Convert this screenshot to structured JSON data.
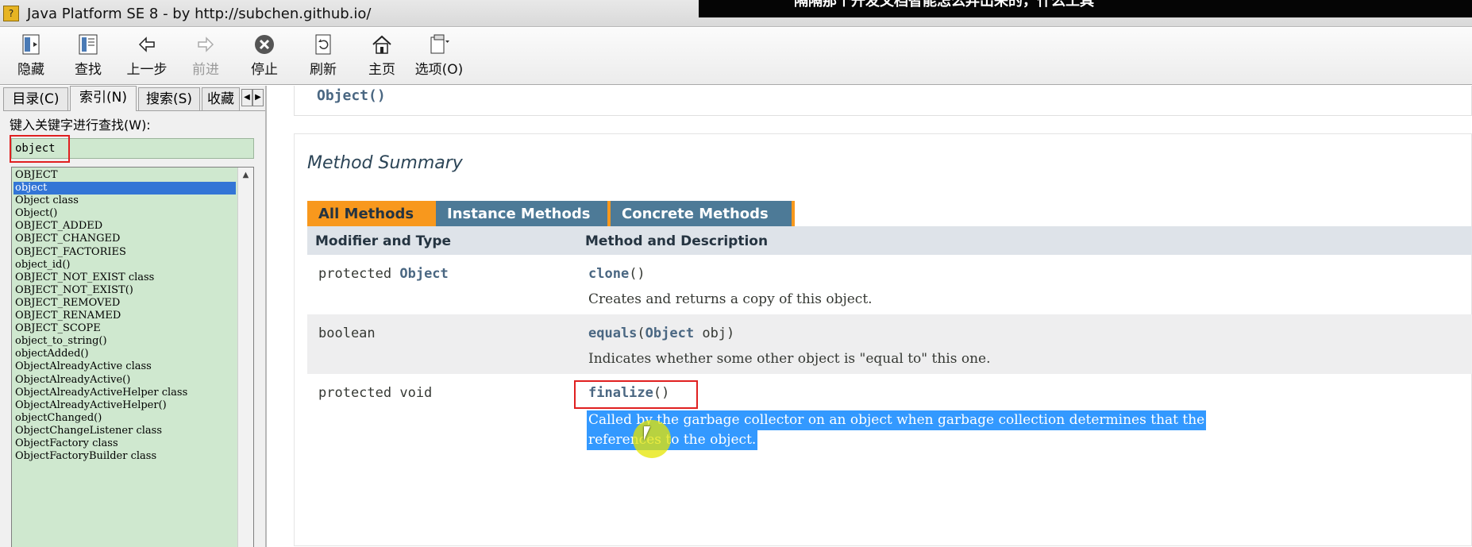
{
  "window": {
    "title": "Java Platform SE 8 - by http://subchen.github.io/",
    "overlay_caption": "隔隔那个开发文档智能怎么弄出来的，什么工具"
  },
  "toolbar": {
    "buttons": [
      {
        "label": "隐藏",
        "icon": "hide-icon"
      },
      {
        "label": "查找",
        "icon": "locate-icon"
      },
      {
        "label": "上一步",
        "icon": "back-arrow-icon"
      },
      {
        "label": "前进",
        "icon": "forward-arrow-icon",
        "disabled": true
      },
      {
        "label": "停止",
        "icon": "stop-icon"
      },
      {
        "label": "刷新",
        "icon": "refresh-icon"
      },
      {
        "label": "主页",
        "icon": "home-icon"
      },
      {
        "label": "选项(O)",
        "icon": "options-icon"
      }
    ]
  },
  "nav": {
    "tabs": [
      "目录(C)",
      "索引(N)",
      "搜索(S)",
      "收藏"
    ],
    "active_tab": "索引(N)",
    "search_prompt": "键入关键字进行查找(W):",
    "keyword_value": "object",
    "results": [
      "OBJECT",
      "object",
      "Object class",
      "Object()",
      "OBJECT_ADDED",
      "OBJECT_CHANGED",
      "OBJECT_FACTORIES",
      "object_id()",
      "OBJECT_NOT_EXIST class",
      "OBJECT_NOT_EXIST()",
      "OBJECT_REMOVED",
      "OBJECT_RENAMED",
      "OBJECT_SCOPE",
      "object_to_string()",
      "objectAdded()",
      "ObjectAlreadyActive class",
      "ObjectAlreadyActive()",
      "ObjectAlreadyActiveHelper class",
      "ObjectAlreadyActiveHelper()",
      "objectChanged()",
      "ObjectChangeListener class",
      "ObjectFactory class",
      "ObjectFactoryBuilder class"
    ],
    "selected_result": "object"
  },
  "content": {
    "constructor_code": "Object()",
    "section_title": "Method Summary",
    "method_tabs": [
      "All Methods",
      "Instance Methods",
      "Concrete Methods"
    ],
    "columns": [
      "Modifier and Type",
      "Method and Description"
    ],
    "methods": [
      {
        "modifier": "protected ",
        "type": "Object",
        "name": "clone",
        "params": "()",
        "desc": "Creates and returns a copy of this object."
      },
      {
        "modifier": "boolean",
        "type": "",
        "name": "equals",
        "params_pre": "(",
        "param_type": "Object",
        "params_post": " obj)",
        "desc": "Indicates whether some other object is \"equal to\" this one."
      },
      {
        "modifier": "protected void",
        "type": "",
        "name": "finalize",
        "params": "()",
        "desc_line1": "Called by the garbage collector on an object when garbage collection determines that the",
        "desc_line2": "references to the object."
      }
    ]
  },
  "colors": {
    "accent_orange": "#f8981d",
    "tab_blue": "#4d7a97",
    "header_gray": "#dee3e9",
    "nav_green": "#cfe8cf",
    "selection_blue": "#3399ff",
    "highlight_red": "#e02020"
  }
}
